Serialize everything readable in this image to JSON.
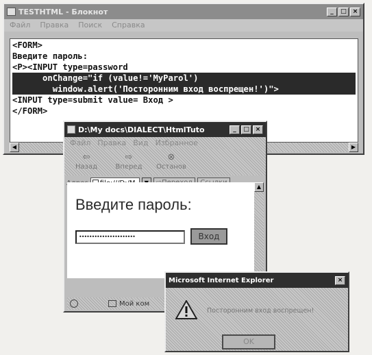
{
  "notepad": {
    "title": "TESTHTML - Блокнот",
    "menu": [
      "Файл",
      "Правка",
      "Поиск",
      "Справка"
    ],
    "code_lines": [
      "<FORM>",
      "Введите пароль:",
      "<P><INPUT type=password",
      "      onChange=\"if (value!='MyParol')",
      "        window.alert('Посторонним вход воспрещен!')\">",
      "<INPUT type=submit value= Вход >",
      "</FORM>"
    ],
    "selected_lines": [
      3,
      4
    ]
  },
  "ie": {
    "title": "D:\\My docs\\DIALECT\\HtmlTuto",
    "menu": [
      "Файл",
      "Правка",
      "Вид",
      "Избранное"
    ],
    "toolbar": [
      "Назад",
      "Вперед",
      "Останов"
    ],
    "address_label": "Адрес",
    "address_value": "file:///D:/M",
    "go_label": "Переход",
    "links_label": "Ссылки",
    "page": {
      "heading": "Введите пароль:",
      "password_mask": "••••••••••••••••••••••",
      "submit_label": "Вход"
    },
    "status_text": "Мой ком"
  },
  "alert": {
    "title": "Microsoft Internet Explorer",
    "message": "Посторонним вход воспрещен!",
    "ok_label": "OK"
  }
}
